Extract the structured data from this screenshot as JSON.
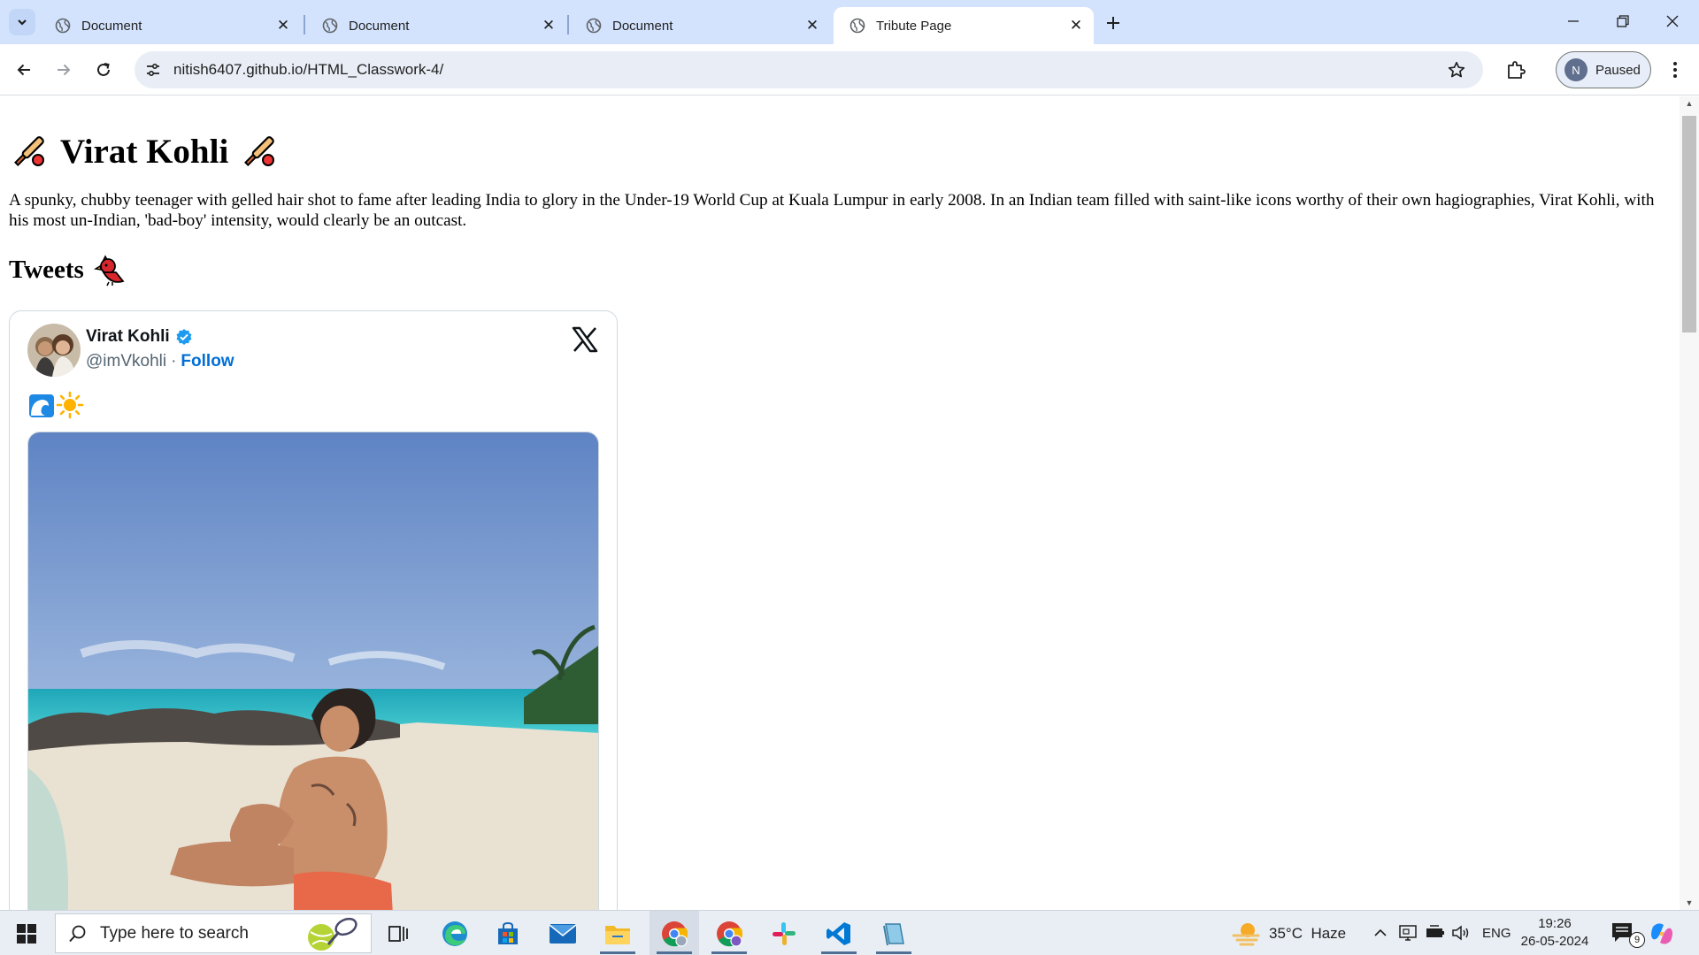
{
  "browser": {
    "tabs": [
      {
        "title": "Document",
        "active": false
      },
      {
        "title": "Document",
        "active": false
      },
      {
        "title": "Document",
        "active": false
      },
      {
        "title": "Tribute Page",
        "active": true
      }
    ],
    "url": "nitish6407.github.io/HTML_Classwork-4/",
    "profile_initial": "N",
    "profile_status": "Paused"
  },
  "page": {
    "heading": "Virat Kohli",
    "heading_emoji": "cricket-bat-icon",
    "bio": "A spunky, chubby teenager with gelled hair shot to fame after leading India to glory in the Under-19 World Cup at Kuala Lumpur in early 2008. In an Indian team filled with saint-like icons worthy of their own hagiographies, Virat Kohli, with his most un-Indian, 'bad-boy' intensity, would clearly be an outcast.",
    "tweets_heading": "Tweets",
    "tweets_emoji": "bird-icon",
    "tweet": {
      "name": "Virat Kohli",
      "handle": "@imVkohli",
      "separator": "·",
      "follow": "Follow",
      "verified": true,
      "body_emoji": [
        "wave-icon",
        "sun-icon"
      ]
    }
  },
  "taskbar": {
    "search_placeholder": "Type here to search",
    "weather_temp": "35°C",
    "weather_text": "Haze",
    "language": "ENG",
    "time": "19:26",
    "date": "26-05-2024",
    "notification_count": "9"
  },
  "colors": {
    "tabstrip": "#d3e3fd",
    "omnibox": "#e9eef6",
    "follow_link": "#006fd6",
    "verified_badge": "#1d9bf0"
  }
}
